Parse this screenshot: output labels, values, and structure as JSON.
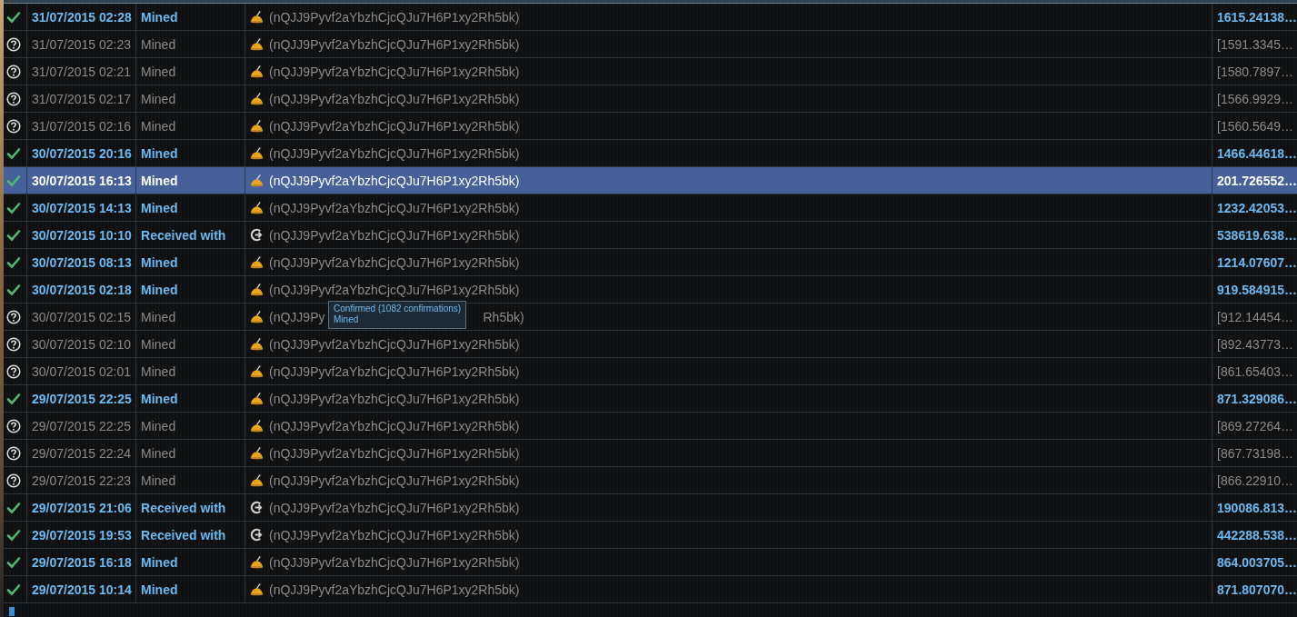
{
  "rows": [
    {
      "confirmed": true,
      "selected": false,
      "kind": "mined",
      "date": "31/07/2015 02:28",
      "type": "Mined",
      "address": "(nQJJ9Pyvf2aYbzhCjcQJu7H6P1xy2Rh5bk)",
      "amount": "1615.24138…"
    },
    {
      "confirmed": false,
      "selected": false,
      "kind": "mined",
      "date": "31/07/2015 02:23",
      "type": "Mined",
      "address": "(nQJJ9Pyvf2aYbzhCjcQJu7H6P1xy2Rh5bk)",
      "amount": "[1591.3345…"
    },
    {
      "confirmed": false,
      "selected": false,
      "kind": "mined",
      "date": "31/07/2015 02:21",
      "type": "Mined",
      "address": "(nQJJ9Pyvf2aYbzhCjcQJu7H6P1xy2Rh5bk)",
      "amount": "[1580.7897…"
    },
    {
      "confirmed": false,
      "selected": false,
      "kind": "mined",
      "date": "31/07/2015 02:17",
      "type": "Mined",
      "address": "(nQJJ9Pyvf2aYbzhCjcQJu7H6P1xy2Rh5bk)",
      "amount": "[1566.9929…"
    },
    {
      "confirmed": false,
      "selected": false,
      "kind": "mined",
      "date": "31/07/2015 02:16",
      "type": "Mined",
      "address": "(nQJJ9Pyvf2aYbzhCjcQJu7H6P1xy2Rh5bk)",
      "amount": "[1560.5649…"
    },
    {
      "confirmed": true,
      "selected": false,
      "kind": "mined",
      "date": "30/07/2015 20:16",
      "type": "Mined",
      "address": "(nQJJ9Pyvf2aYbzhCjcQJu7H6P1xy2Rh5bk)",
      "amount": "1466.44618…"
    },
    {
      "confirmed": true,
      "selected": true,
      "kind": "mined",
      "date": "30/07/2015 16:13",
      "type": "Mined",
      "address": "(nQJJ9Pyvf2aYbzhCjcQJu7H6P1xy2Rh5bk)",
      "amount": "201.726552…"
    },
    {
      "confirmed": true,
      "selected": false,
      "kind": "mined",
      "date": "30/07/2015 14:13",
      "type": "Mined",
      "address": "(nQJJ9Pyvf2aYbzhCjcQJu7H6P1xy2Rh5bk)",
      "amount": "1232.42053…"
    },
    {
      "confirmed": true,
      "selected": false,
      "kind": "received",
      "date": "30/07/2015 10:10",
      "type": "Received with",
      "address": "(nQJJ9Pyvf2aYbzhCjcQJu7H6P1xy2Rh5bk)",
      "amount": "538619.638…"
    },
    {
      "confirmed": true,
      "selected": false,
      "kind": "mined",
      "date": "30/07/2015 08:13",
      "type": "Mined",
      "address": "(nQJJ9Pyvf2aYbzhCjcQJu7H6P1xy2Rh5bk)",
      "amount": "1214.07607…"
    },
    {
      "confirmed": true,
      "selected": false,
      "kind": "mined",
      "date": "30/07/2015 02:18",
      "type": "Mined",
      "address": "(nQJJ9Pyvf2aYbzhCjcQJu7H6P1xy2Rh5bk)",
      "amount": "919.584915…"
    },
    {
      "confirmed": false,
      "selected": false,
      "kind": "mined",
      "date": "30/07/2015 02:15",
      "type": "Mined",
      "address_parts": [
        "(nQJJ9Py",
        "Rh5bk)"
      ],
      "amount": "[912.14454…"
    },
    {
      "confirmed": false,
      "selected": false,
      "kind": "mined",
      "date": "30/07/2015 02:10",
      "type": "Mined",
      "address": "(nQJJ9Pyvf2aYbzhCjcQJu7H6P1xy2Rh5bk)",
      "amount": "[892.43773…"
    },
    {
      "confirmed": false,
      "selected": false,
      "kind": "mined",
      "date": "30/07/2015 02:01",
      "type": "Mined",
      "address": "(nQJJ9Pyvf2aYbzhCjcQJu7H6P1xy2Rh5bk)",
      "amount": "[861.65403…"
    },
    {
      "confirmed": true,
      "selected": false,
      "kind": "mined",
      "date": "29/07/2015 22:25",
      "type": "Mined",
      "address": "(nQJJ9Pyvf2aYbzhCjcQJu7H6P1xy2Rh5bk)",
      "amount": "871.329086…"
    },
    {
      "confirmed": false,
      "selected": false,
      "kind": "mined",
      "date": "29/07/2015 22:25",
      "type": "Mined",
      "address": "(nQJJ9Pyvf2aYbzhCjcQJu7H6P1xy2Rh5bk)",
      "amount": "[869.27264…"
    },
    {
      "confirmed": false,
      "selected": false,
      "kind": "mined",
      "date": "29/07/2015 22:24",
      "type": "Mined",
      "address": "(nQJJ9Pyvf2aYbzhCjcQJu7H6P1xy2Rh5bk)",
      "amount": "[867.73198…"
    },
    {
      "confirmed": false,
      "selected": false,
      "kind": "mined",
      "date": "29/07/2015 22:23",
      "type": "Mined",
      "address": "(nQJJ9Pyvf2aYbzhCjcQJu7H6P1xy2Rh5bk)",
      "amount": "[866.22910…"
    },
    {
      "confirmed": true,
      "selected": false,
      "kind": "received",
      "date": "29/07/2015 21:06",
      "type": "Received with",
      "address": "(nQJJ9Pyvf2aYbzhCjcQJu7H6P1xy2Rh5bk)",
      "amount": "190086.813…"
    },
    {
      "confirmed": true,
      "selected": false,
      "kind": "received",
      "date": "29/07/2015 19:53",
      "type": "Received with",
      "address": "(nQJJ9Pyvf2aYbzhCjcQJu7H6P1xy2Rh5bk)",
      "amount": "442288.538…"
    },
    {
      "confirmed": true,
      "selected": false,
      "kind": "mined",
      "date": "29/07/2015 16:18",
      "type": "Mined",
      "address": "(nQJJ9Pyvf2aYbzhCjcQJu7H6P1xy2Rh5bk)",
      "amount": "864.003705…"
    },
    {
      "confirmed": true,
      "selected": false,
      "kind": "mined",
      "date": "29/07/2015 10:14",
      "type": "Mined",
      "address": "(nQJJ9Pyvf2aYbzhCjcQJu7H6P1xy2Rh5bk)",
      "amount": "871.807070…"
    }
  ],
  "tooltip": {
    "lines": [
      "Confirmed (1082 confirmations)",
      "Mined"
    ]
  }
}
